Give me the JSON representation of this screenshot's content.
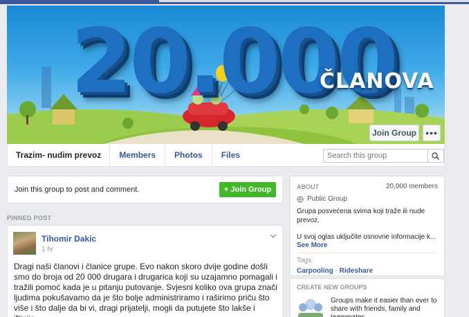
{
  "cover": {
    "big_text": "20.000",
    "title": "ČLANOVA",
    "join_label": "Join Group",
    "more_label": "•••"
  },
  "nav": {
    "group_name": "Trazim- nudim prevoz",
    "tabs": [
      "Members",
      "Photos",
      "Files"
    ],
    "search_placeholder": "Search this group"
  },
  "join_card": {
    "text": "Join this group to post and comment.",
    "button_label": "+ Join Group"
  },
  "pinned_label": "PINNED POST",
  "post": {
    "author": "Tihomir Dakic",
    "time": "1 hr",
    "body": "Dragi naši članovi i članice grupe. Evo nakon skoro dvije godine došli smo do broja od 20 000 drugara i drugarica koji su uzajamno pomagali i tražili pomoć kada je u pitanju putovanje. Svjesni koliko ova grupa znači ljudima pokušavamo da je što bolje administriramo i raširimo priču što više i što dalje da bi vi, dragi prijatelji, mogli da putujete što lakše i jftinije."
  },
  "about": {
    "heading": "ABOUT",
    "members_count": "20,000 members",
    "privacy": "Public Group",
    "description": "Grupa posvećena svima koji traže ili nude prevoz.",
    "description2": "U svoj oglas uključite osnovne informacije k...",
    "see_more": "See More",
    "tags_heading": "Tags:",
    "tags": [
      "Carpooling",
      "Rideshare"
    ],
    "tag_separator": " · "
  },
  "create_groups": {
    "heading": "CREATE NEW GROUPS",
    "text": "Groups make it easier than ever to share with friends, family and teammates."
  },
  "colors": {
    "facebook_blue": "#3b5998",
    "link": "#365899",
    "green": "#42b72a"
  }
}
